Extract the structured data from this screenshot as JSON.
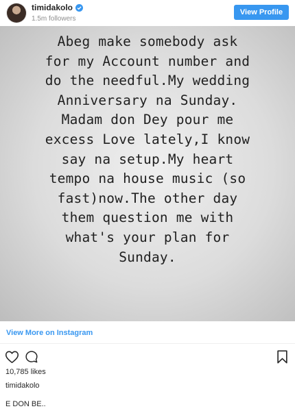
{
  "header": {
    "username": "timidakolo",
    "followers": "1.5m followers",
    "view_profile_label": "View Profile"
  },
  "post": {
    "text_lines": [
      "Abeg make somebody ask",
      "for my Account number and",
      "do the needful.My wedding",
      "Anniversary na Sunday.",
      "Madam don Dey pour me",
      "excess Love lately,I know",
      "say na setup.My heart",
      "tempo na house music (so",
      "fast)now.The other day",
      "them question me with",
      "what's your plan for",
      "Sunday."
    ]
  },
  "footer": {
    "view_more_label": "View More on Instagram",
    "likes": "10,785 likes",
    "caption_username": "timidakolo",
    "caption_text": "E DON BE.."
  },
  "icons": {
    "verified": "verified-badge-icon",
    "like": "heart-icon",
    "comment": "comment-icon",
    "save": "bookmark-icon"
  },
  "colors": {
    "accent": "#3897f0",
    "text": "#262626",
    "muted": "#8e8e8e"
  }
}
